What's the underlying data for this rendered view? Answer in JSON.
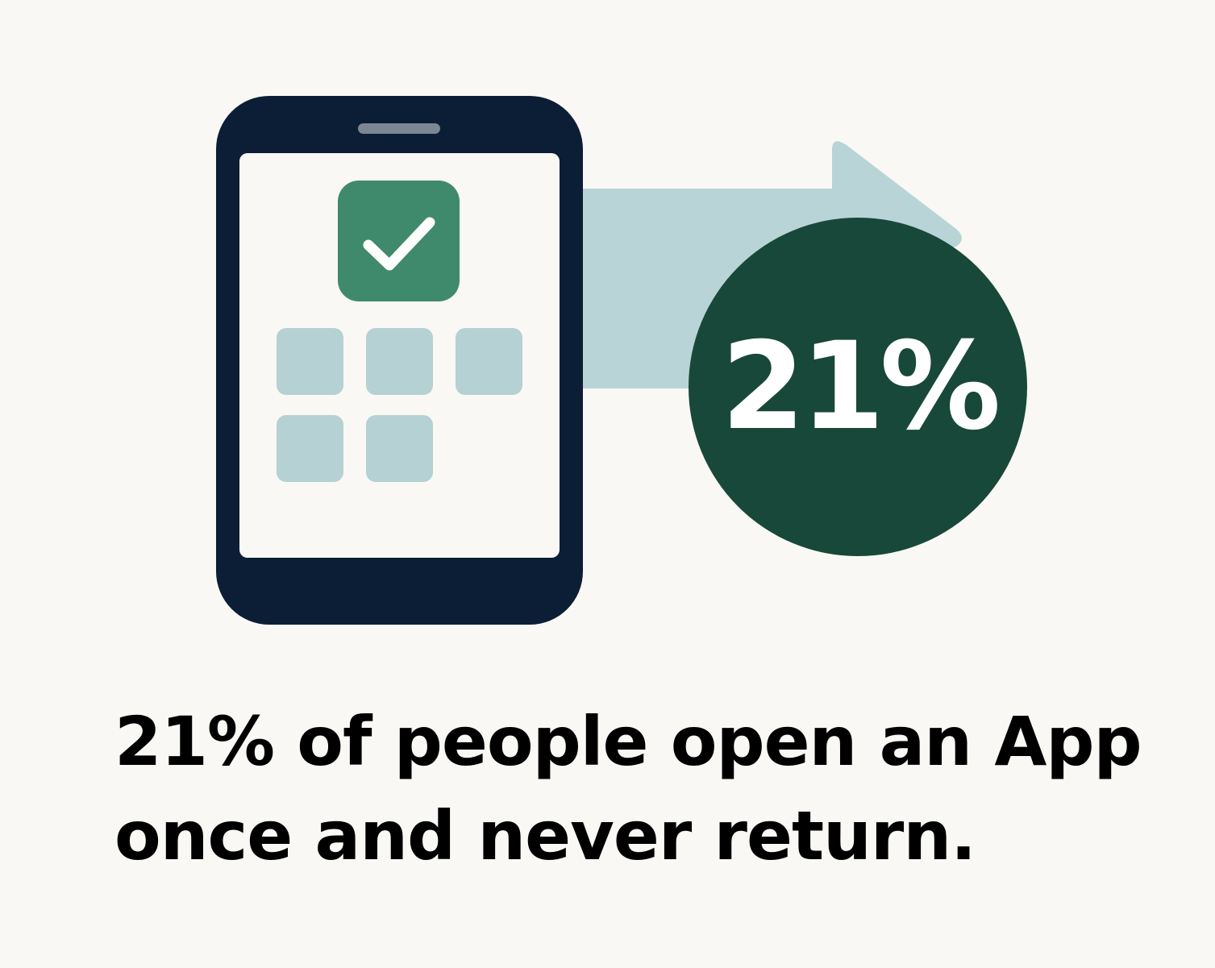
{
  "stat": {
    "value": "21%"
  },
  "headline": {
    "line1": "21% of people open an App",
    "line2": "once and never return."
  },
  "colors": {
    "background": "#f9f8f4",
    "phone_body": "#0b1e35",
    "phone_screen": "#f9f8f4",
    "checked_tile": "#3f8a6c",
    "app_tile": "#b5d1d3",
    "arrow": "#b9d4d6",
    "stat_circle": "#184839",
    "headline_text": "#000000"
  },
  "icons": [
    "smartphone-icon",
    "checkmark-icon",
    "arrow-right-icon"
  ]
}
